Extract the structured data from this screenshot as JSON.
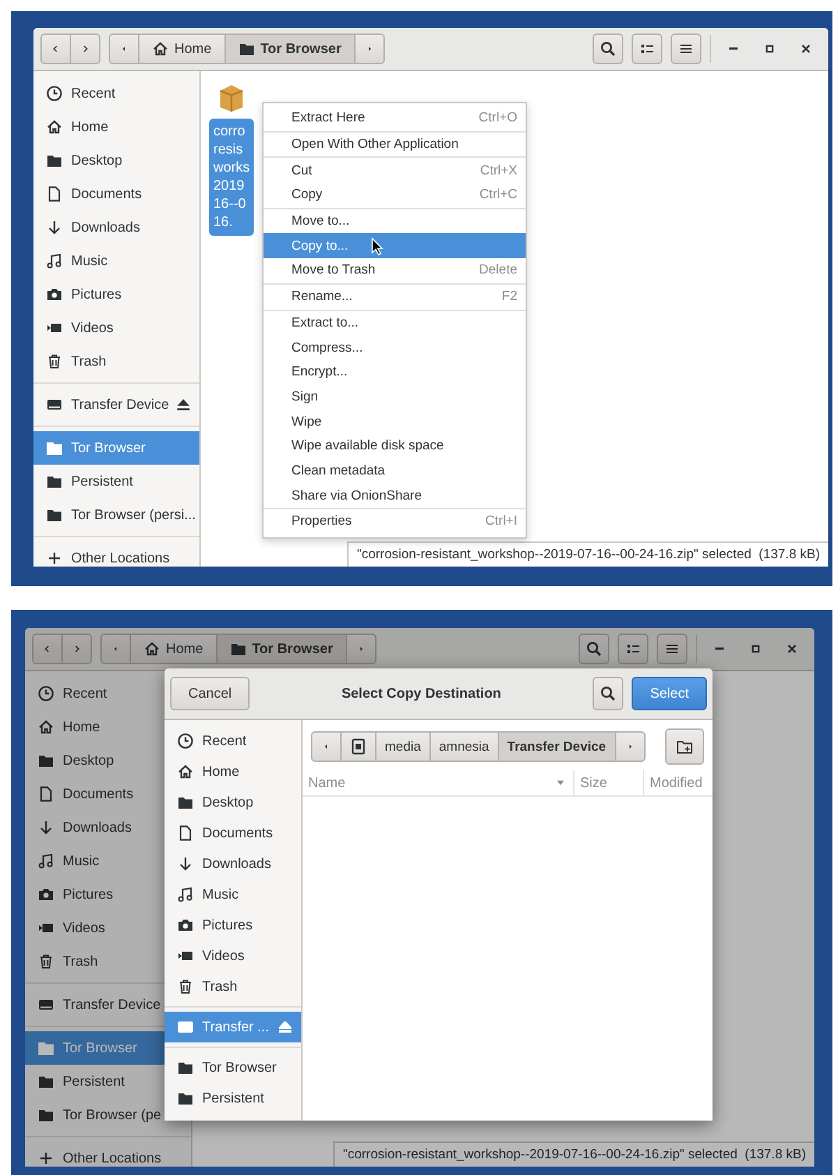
{
  "screenshots": [
    {
      "file_manager": {
        "dimmed": false,
        "path_bar": [
          {
            "kind": "home",
            "label": "Home",
            "selected": false
          },
          {
            "kind": "folder",
            "label": "Tor Browser",
            "selected": true
          }
        ],
        "sidebar": [
          [
            {
              "kind": "recent",
              "label": "Recent",
              "selected": false
            },
            {
              "kind": "home",
              "label": "Home",
              "selected": false
            },
            {
              "kind": "desktop",
              "label": "Desktop",
              "selected": false
            },
            {
              "kind": "documents",
              "label": "Documents",
              "selected": false
            },
            {
              "kind": "downloads",
              "label": "Downloads",
              "selected": false
            },
            {
              "kind": "music",
              "label": "Music",
              "selected": false
            },
            {
              "kind": "pictures",
              "label": "Pictures",
              "selected": false
            },
            {
              "kind": "videos",
              "label": "Videos",
              "selected": false
            },
            {
              "kind": "trash",
              "label": "Trash",
              "selected": false
            }
          ],
          [
            {
              "kind": "device",
              "label": "Transfer Device",
              "selected": false,
              "ejectable": true
            }
          ],
          [
            {
              "kind": "folder",
              "label": "Tor Browser",
              "selected": true
            },
            {
              "kind": "folder",
              "label": "Persistent",
              "selected": false
            },
            {
              "kind": "folder",
              "label": "Tor Browser (persi...",
              "selected": false
            }
          ],
          [
            {
              "kind": "other",
              "label": "Other Locations",
              "selected": false
            }
          ]
        ],
        "files": [
          {
            "name_lines": [
              "corro",
              "resis",
              "works",
              "2019",
              "16--0",
              "16."
            ],
            "selected": true
          }
        ],
        "status": "\"corrosion-resistant_workshop--2019-07-16--00-24-16.zip\" selected  (137.8 kB)"
      },
      "context_menu": [
        [
          {
            "label": "Extract Here",
            "shortcut": "Ctrl+O",
            "selected": false
          }
        ],
        [
          {
            "label": "Open With Other Application",
            "selected": false
          }
        ],
        [
          {
            "label": "Cut",
            "shortcut": "Ctrl+X",
            "selected": false
          },
          {
            "label": "Copy",
            "shortcut": "Ctrl+C",
            "selected": false
          }
        ],
        [
          {
            "label": "Move to...",
            "selected": false
          },
          {
            "label": "Copy to...",
            "selected": true
          },
          {
            "label": "Move to Trash",
            "shortcut": "Delete",
            "selected": false
          }
        ],
        [
          {
            "label": "Rename...",
            "shortcut": "F2",
            "selected": false
          }
        ],
        [
          {
            "label": "Extract to...",
            "selected": false
          },
          {
            "label": "Compress...",
            "selected": false
          },
          {
            "label": "Encrypt...",
            "selected": false
          },
          {
            "label": "Sign",
            "selected": false
          },
          {
            "label": "Wipe",
            "selected": false
          },
          {
            "label": "Wipe available disk space",
            "selected": false
          },
          {
            "label": "Clean metadata",
            "selected": false
          },
          {
            "label": "Share via OnionShare",
            "selected": false
          }
        ],
        [
          {
            "label": "Properties",
            "shortcut": "Ctrl+I",
            "selected": false
          }
        ]
      ]
    },
    {
      "file_manager": {
        "dimmed": true,
        "path_bar": [
          {
            "kind": "home",
            "label": "Home",
            "selected": false
          },
          {
            "kind": "folder",
            "label": "Tor Browser",
            "selected": true
          }
        ],
        "sidebar": [
          [
            {
              "kind": "recent",
              "label": "Recent",
              "selected": false
            },
            {
              "kind": "home",
              "label": "Home",
              "selected": false
            },
            {
              "kind": "desktop",
              "label": "Desktop",
              "selected": false
            },
            {
              "kind": "documents",
              "label": "Documents",
              "selected": false
            },
            {
              "kind": "downloads",
              "label": "Downloads",
              "selected": false
            },
            {
              "kind": "music",
              "label": "Music",
              "selected": false
            },
            {
              "kind": "pictures",
              "label": "Pictures",
              "selected": false
            },
            {
              "kind": "videos",
              "label": "Videos",
              "selected": false
            },
            {
              "kind": "trash",
              "label": "Trash",
              "selected": false
            }
          ],
          [
            {
              "kind": "device",
              "label": "Transfer Device",
              "selected": false,
              "ejectable": false
            }
          ],
          [
            {
              "kind": "folder",
              "label": "Tor Browser",
              "selected": true
            },
            {
              "kind": "folder",
              "label": "Persistent",
              "selected": false
            },
            {
              "kind": "folder",
              "label": "Tor Browser (pe",
              "selected": false
            }
          ],
          [
            {
              "kind": "other",
              "label": "Other Locations",
              "selected": false
            }
          ]
        ],
        "status": "\"corrosion-resistant_workshop--2019-07-16--00-24-16.zip\" selected  (137.8 kB)"
      },
      "dialog": {
        "title": "Select Copy Destination",
        "cancel": "Cancel",
        "confirm": "Select",
        "sidebar": [
          [
            {
              "kind": "recent",
              "label": "Recent",
              "selected": false
            },
            {
              "kind": "home",
              "label": "Home",
              "selected": false
            },
            {
              "kind": "desktop",
              "label": "Desktop",
              "selected": false
            },
            {
              "kind": "documents",
              "label": "Documents",
              "selected": false
            },
            {
              "kind": "downloads",
              "label": "Downloads",
              "selected": false
            },
            {
              "kind": "music",
              "label": "Music",
              "selected": false
            },
            {
              "kind": "pictures",
              "label": "Pictures",
              "selected": false
            },
            {
              "kind": "videos",
              "label": "Videos",
              "selected": false
            },
            {
              "kind": "trash",
              "label": "Trash",
              "selected": false
            }
          ],
          [
            {
              "kind": "device",
              "label": "Transfer ...",
              "selected": true,
              "ejectable": true
            }
          ],
          [
            {
              "kind": "folder",
              "label": "Tor Browser",
              "selected": false
            },
            {
              "kind": "folder",
              "label": "Persistent",
              "selected": false
            }
          ]
        ],
        "path_bar": [
          {
            "kind": "drive",
            "selected": false
          },
          {
            "kind": "plain",
            "label": "media",
            "selected": false
          },
          {
            "kind": "plain",
            "label": "amnesia",
            "selected": false
          },
          {
            "kind": "plain",
            "label": "Transfer Device",
            "selected": true
          }
        ],
        "columns": [
          {
            "label": "Name",
            "sorted": true
          },
          {
            "label": "Size",
            "sorted": false
          },
          {
            "label": "Modified",
            "sorted": false
          }
        ]
      }
    }
  ]
}
